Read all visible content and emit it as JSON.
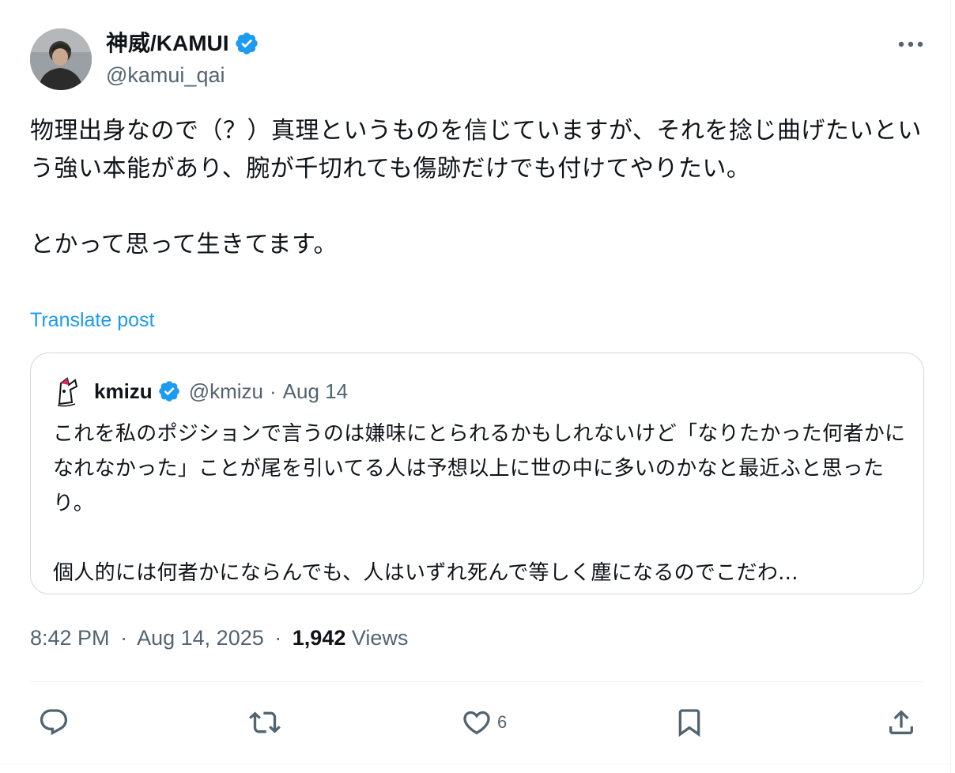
{
  "author": {
    "display_name": "神威/KAMUI",
    "handle": "@kamui_qai",
    "avatar_icon": "person-photo-avatar",
    "verified_icon": "verified-badge-icon"
  },
  "tweet": {
    "text": "物理出身なので（？）真理というものを信じていますが、それを捻じ曲げたいという強い本能があり、腕が千切れても傷跡だけでも付けてやりたい。\n\nとかって思って生きてます。",
    "translate_label": "Translate post"
  },
  "quote": {
    "display_name": "kmizu",
    "handle": "@kmizu",
    "separator": "·",
    "date": "Aug 14",
    "text": "これを私のポジションで言うのは嫌味にとられるかもしれないけど「なりたかった何者かになれなかった」ことが尾を引いてる人は予想以上に世の中に多いのかなと最近ふと思ったり。\n\n個人的には何者かにならんでも、人はいずれ死んで等しく塵になるのでこだわ..."
  },
  "meta": {
    "time": "8:42 PM",
    "sep1": "·",
    "date": "Aug 14, 2025",
    "sep2": "·",
    "views_count": "1,942",
    "views_label": "Views"
  },
  "actions": {
    "reply_icon": "reply-icon",
    "retweet_icon": "retweet-icon",
    "like_icon": "heart-icon",
    "like_count": "6",
    "bookmark_icon": "bookmark-icon",
    "share_icon": "share-icon"
  },
  "colors": {
    "accent": "#1d9bf0",
    "text_primary": "#0f1419",
    "text_secondary": "#536471",
    "border": "#cfd9de"
  }
}
